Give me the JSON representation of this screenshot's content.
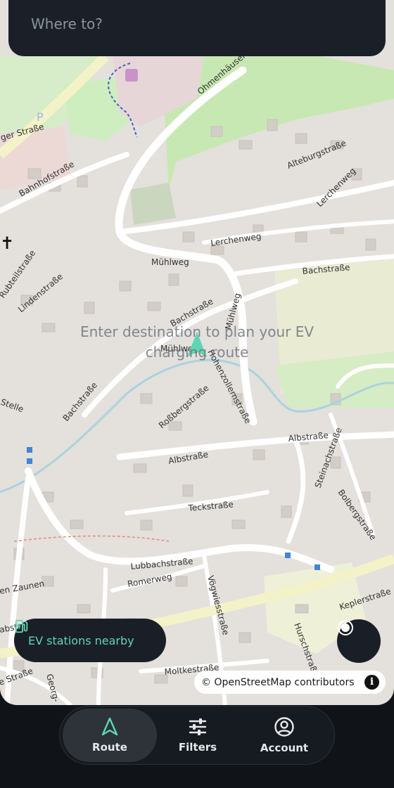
{
  "search": {
    "placeholder": "Where to?"
  },
  "map": {
    "hint": "Enter destination to plan your EV charging route",
    "attribution": "© OpenStreetMap contributors",
    "info_label": "i",
    "street_labels": [
      "Ohmenhäuser",
      "Alteburgstraße",
      "Lerchenweg",
      "Bachstraße",
      "Mühlweg",
      "Bahnhofstraße",
      "Rubteilstraße",
      "Lindenstraße",
      "Bachstraße",
      "Mühlweg",
      "Bachstraße",
      "Hohenzollernstraße",
      "Roßbergstraße",
      "Albstraße",
      "Albstraße",
      "Steinachstraße",
      "Bolbergstraße",
      "Teckstraße",
      "Lubbachstraße",
      "Romerweg",
      "Vögwiesstraße",
      "Keplerstraße",
      "Hurschstraße",
      "Moltkestraße",
      "Georg-",
      "en Zaunen",
      "abstraße",
      "e Straße",
      "ger Straße",
      "Stelle",
      "Lerchenweg",
      "Mühlweg"
    ]
  },
  "ev_button": {
    "label": "EV stations nearby"
  },
  "nav": {
    "items": [
      {
        "label": "Route",
        "icon": "navigation-arrow-icon",
        "active": true
      },
      {
        "label": "Filters",
        "icon": "sliders-icon",
        "active": false
      },
      {
        "label": "Account",
        "icon": "account-circle-icon",
        "active": false
      }
    ]
  },
  "colors": {
    "accent": "#5fd6b3",
    "panel": "#1b2028",
    "map_background": "#e4e0dc",
    "park_green": "#b9e3a3",
    "water": "#a9d3df"
  }
}
